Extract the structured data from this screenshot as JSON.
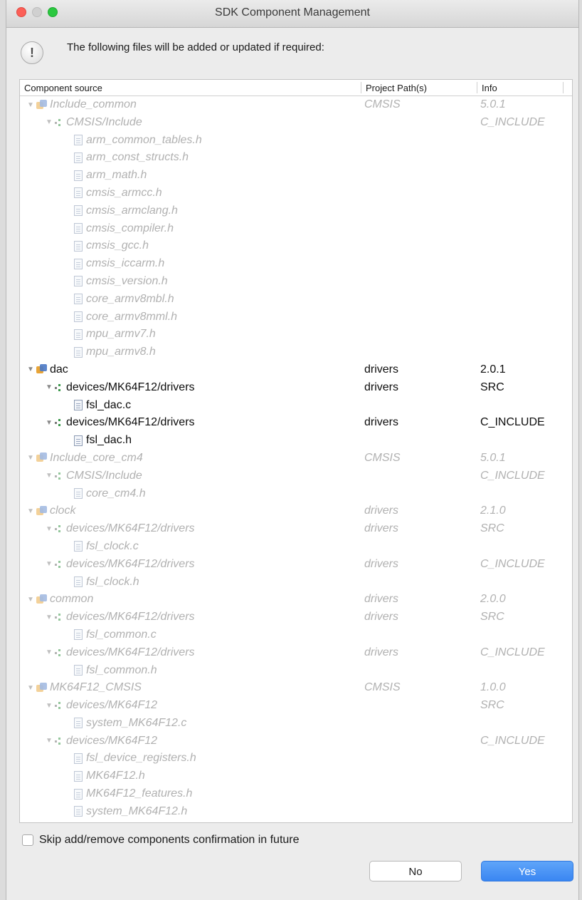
{
  "window": {
    "title": "SDK Component Management"
  },
  "message": "The following files will be added or updated if required:",
  "table": {
    "headers": {
      "source": "Component source",
      "path": "Project Path(s)",
      "info": "Info"
    },
    "rows": [
      {
        "level": 0,
        "kind": "component",
        "state": "dim",
        "label": "Include_common",
        "path": "CMSIS",
        "info": "5.0.1"
      },
      {
        "level": 1,
        "kind": "folder",
        "state": "dim",
        "label": "CMSIS/Include",
        "path": "",
        "info": "C_INCLUDE"
      },
      {
        "level": 2,
        "kind": "file",
        "state": "dim",
        "label": "arm_common_tables.h",
        "path": "",
        "info": ""
      },
      {
        "level": 2,
        "kind": "file",
        "state": "dim",
        "label": "arm_const_structs.h",
        "path": "",
        "info": ""
      },
      {
        "level": 2,
        "kind": "file",
        "state": "dim",
        "label": "arm_math.h",
        "path": "",
        "info": ""
      },
      {
        "level": 2,
        "kind": "file",
        "state": "dim",
        "label": "cmsis_armcc.h",
        "path": "",
        "info": ""
      },
      {
        "level": 2,
        "kind": "file",
        "state": "dim",
        "label": "cmsis_armclang.h",
        "path": "",
        "info": ""
      },
      {
        "level": 2,
        "kind": "file",
        "state": "dim",
        "label": "cmsis_compiler.h",
        "path": "",
        "info": ""
      },
      {
        "level": 2,
        "kind": "file",
        "state": "dim",
        "label": "cmsis_gcc.h",
        "path": "",
        "info": ""
      },
      {
        "level": 2,
        "kind": "file",
        "state": "dim",
        "label": "cmsis_iccarm.h",
        "path": "",
        "info": ""
      },
      {
        "level": 2,
        "kind": "file",
        "state": "dim",
        "label": "cmsis_version.h",
        "path": "",
        "info": ""
      },
      {
        "level": 2,
        "kind": "file",
        "state": "dim",
        "label": "core_armv8mbl.h",
        "path": "",
        "info": ""
      },
      {
        "level": 2,
        "kind": "file",
        "state": "dim",
        "label": "core_armv8mml.h",
        "path": "",
        "info": ""
      },
      {
        "level": 2,
        "kind": "file",
        "state": "dim",
        "label": "mpu_armv7.h",
        "path": "",
        "info": ""
      },
      {
        "level": 2,
        "kind": "file",
        "state": "dim",
        "label": "mpu_armv8.h",
        "path": "",
        "info": ""
      },
      {
        "level": 0,
        "kind": "component",
        "state": "act",
        "label": "dac",
        "path": "drivers",
        "info": "2.0.1"
      },
      {
        "level": 1,
        "kind": "folder",
        "state": "act",
        "label": "devices/MK64F12/drivers",
        "path": "drivers",
        "info": "SRC"
      },
      {
        "level": 2,
        "kind": "file",
        "state": "act",
        "label": "fsl_dac.c",
        "path": "",
        "info": ""
      },
      {
        "level": 1,
        "kind": "folder",
        "state": "act",
        "label": "devices/MK64F12/drivers",
        "path": "drivers",
        "info": "C_INCLUDE"
      },
      {
        "level": 2,
        "kind": "file",
        "state": "act",
        "label": "fsl_dac.h",
        "path": "",
        "info": ""
      },
      {
        "level": 0,
        "kind": "component",
        "state": "dim",
        "label": "Include_core_cm4",
        "path": "CMSIS",
        "info": "5.0.1"
      },
      {
        "level": 1,
        "kind": "folder",
        "state": "dim",
        "label": "CMSIS/Include",
        "path": "",
        "info": "C_INCLUDE"
      },
      {
        "level": 2,
        "kind": "file",
        "state": "dim",
        "label": "core_cm4.h",
        "path": "",
        "info": ""
      },
      {
        "level": 0,
        "kind": "component",
        "state": "dim",
        "label": "clock",
        "path": "drivers",
        "info": "2.1.0"
      },
      {
        "level": 1,
        "kind": "folder",
        "state": "dim",
        "label": "devices/MK64F12/drivers",
        "path": "drivers",
        "info": "SRC"
      },
      {
        "level": 2,
        "kind": "file",
        "state": "dim",
        "label": "fsl_clock.c",
        "path": "",
        "info": ""
      },
      {
        "level": 1,
        "kind": "folder",
        "state": "dim",
        "label": "devices/MK64F12/drivers",
        "path": "drivers",
        "info": "C_INCLUDE"
      },
      {
        "level": 2,
        "kind": "file",
        "state": "dim",
        "label": "fsl_clock.h",
        "path": "",
        "info": ""
      },
      {
        "level": 0,
        "kind": "component",
        "state": "dim",
        "label": "common",
        "path": "drivers",
        "info": "2.0.0"
      },
      {
        "level": 1,
        "kind": "folder",
        "state": "dim",
        "label": "devices/MK64F12/drivers",
        "path": "drivers",
        "info": "SRC"
      },
      {
        "level": 2,
        "kind": "file",
        "state": "dim",
        "label": "fsl_common.c",
        "path": "",
        "info": ""
      },
      {
        "level": 1,
        "kind": "folder",
        "state": "dim",
        "label": "devices/MK64F12/drivers",
        "path": "drivers",
        "info": "C_INCLUDE"
      },
      {
        "level": 2,
        "kind": "file",
        "state": "dim",
        "label": "fsl_common.h",
        "path": "",
        "info": ""
      },
      {
        "level": 0,
        "kind": "component",
        "state": "dim",
        "label": "MK64F12_CMSIS",
        "path": "CMSIS",
        "info": "1.0.0"
      },
      {
        "level": 1,
        "kind": "folder",
        "state": "dim",
        "label": "devices/MK64F12",
        "path": "",
        "info": "SRC"
      },
      {
        "level": 2,
        "kind": "file",
        "state": "dim",
        "label": "system_MK64F12.c",
        "path": "",
        "info": ""
      },
      {
        "level": 1,
        "kind": "folder",
        "state": "dim",
        "label": "devices/MK64F12",
        "path": "",
        "info": "C_INCLUDE"
      },
      {
        "level": 2,
        "kind": "file",
        "state": "dim",
        "label": "fsl_device_registers.h",
        "path": "",
        "info": ""
      },
      {
        "level": 2,
        "kind": "file",
        "state": "dim",
        "label": "MK64F12.h",
        "path": "",
        "info": ""
      },
      {
        "level": 2,
        "kind": "file",
        "state": "dim",
        "label": "MK64F12_features.h",
        "path": "",
        "info": ""
      },
      {
        "level": 2,
        "kind": "file",
        "state": "dim",
        "label": "system_MK64F12.h",
        "path": "",
        "info": ""
      }
    ]
  },
  "skip_checkbox": {
    "label": "Skip add/remove components confirmation in future",
    "checked": false
  },
  "buttons": {
    "no": "No",
    "yes": "Yes"
  }
}
